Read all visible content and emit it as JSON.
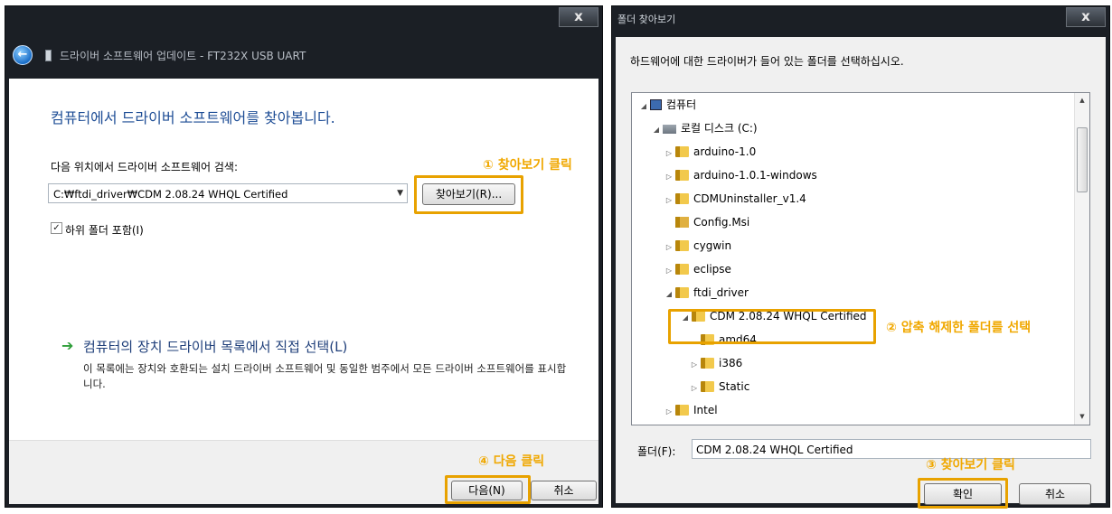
{
  "left_window": {
    "close_label": "x",
    "title": "드라이버 소프트웨어 업데이트 - FT232X USB UART",
    "heading": "컴퓨터에서 드라이버 소프트웨어를 찾아봅니다.",
    "search_label": "다음 위치에서 드라이버 소프트웨어 검색:",
    "path_value": "C:₩ftdi_driver₩CDM 2.08.24 WHQL Certified",
    "browse_label": "찾아보기(R)...",
    "include_subfolders_label": "하위 폴더 포함(I)",
    "include_subfolders_checked": true,
    "pick_title": "컴퓨터의 장치 드라이버 목록에서 직접 선택(L)",
    "pick_description": "이 목록에는 장치와 호환되는 설치 드라이버 소프트웨어 및 동일한 범주에서 모든 드라이버 소프트웨어를 표시합니다.",
    "next_label": "다음(N)",
    "cancel_label": "취소"
  },
  "right_window": {
    "title": "폴더 찾아보기",
    "close_label": "x",
    "instruction": "하드웨어에 대한 드라이버가 들어 있는 폴더를 선택하십시오.",
    "tree": [
      {
        "label": "컴퓨터",
        "toggle": "◢",
        "icon": "computer"
      },
      {
        "label": "로컬 디스크 (C:)",
        "toggle": "◢",
        "icon": "drive"
      },
      {
        "label": "arduino-1.0",
        "toggle": "▷",
        "icon": "folder"
      },
      {
        "label": "arduino-1.0.1-windows",
        "toggle": "▷",
        "icon": "folder"
      },
      {
        "label": "CDMUninstaller_v1.4",
        "toggle": "▷",
        "icon": "folder"
      },
      {
        "label": "Config.Msi",
        "toggle": "",
        "icon": "config"
      },
      {
        "label": "cygwin",
        "toggle": "▷",
        "icon": "folder"
      },
      {
        "label": "eclipse",
        "toggle": "▷",
        "icon": "folder"
      },
      {
        "label": "ftdi_driver",
        "toggle": "◢",
        "icon": "folder"
      },
      {
        "label": "CDM 2.08.24 WHQL Certified",
        "toggle": "◢",
        "icon": "folder",
        "selected": true
      },
      {
        "label": "amd64",
        "toggle": "",
        "icon": "folder"
      },
      {
        "label": "i386",
        "toggle": "▷",
        "icon": "folder"
      },
      {
        "label": "Static",
        "toggle": "▷",
        "icon": "folder"
      },
      {
        "label": "Intel",
        "toggle": "▷",
        "icon": "folder"
      }
    ],
    "folder_label": "폴더(F):",
    "folder_value": "CDM 2.08.24 WHQL Certified",
    "ok_label": "확인",
    "cancel_label": "취소"
  },
  "annotations": {
    "step1": "① 찾아보기 클릭",
    "step2": "② 압축 해제한 폴더를 선택",
    "step3": "③ 찾아보기 클릭",
    "step4": "④ 다음 클릭"
  },
  "colors": {
    "annotation": "#f0a800",
    "heading": "#1f4e96",
    "titlebar": "#1b1f25"
  }
}
